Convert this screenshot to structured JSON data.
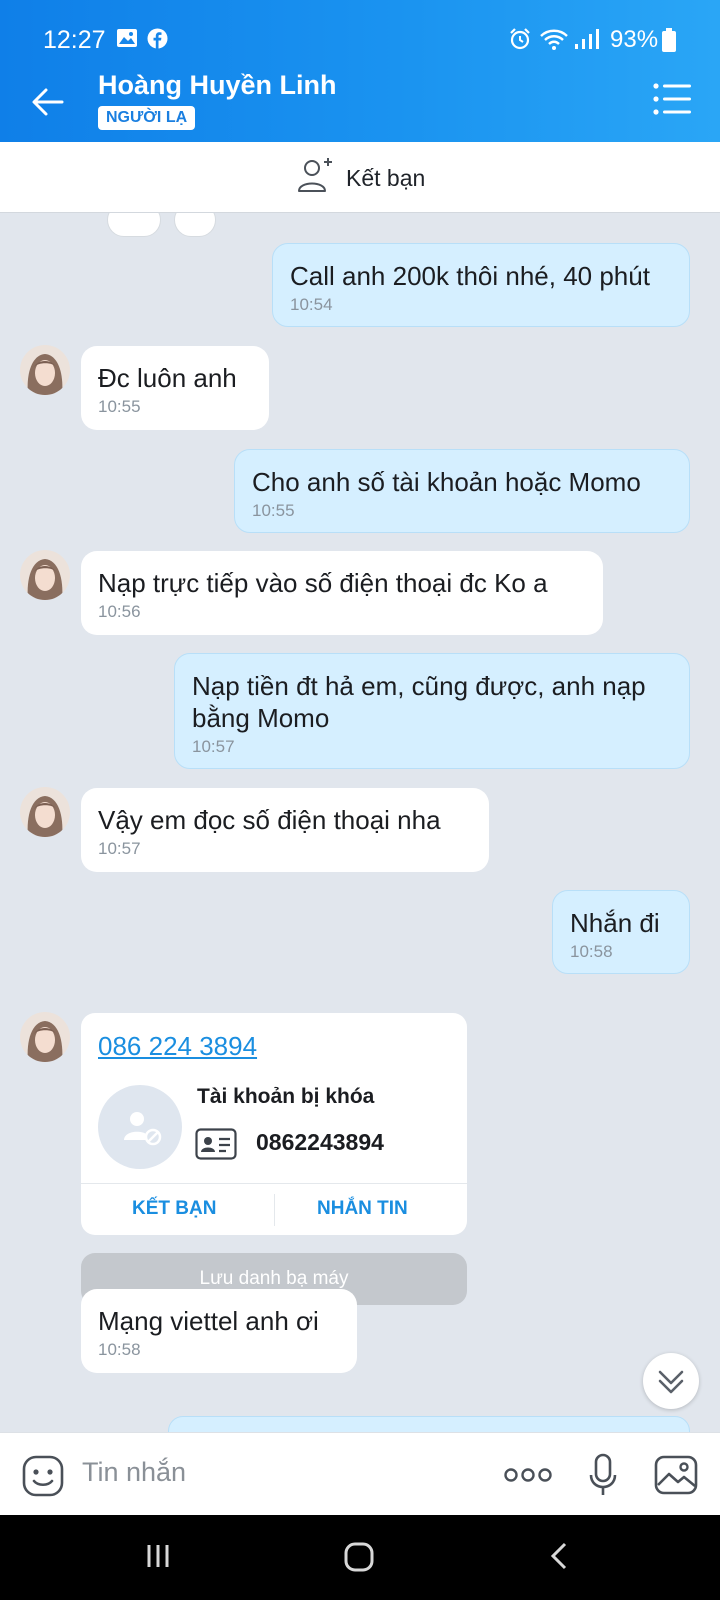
{
  "status_bar": {
    "time": "12:27",
    "battery": "93%"
  },
  "header": {
    "contact_name": "Hoàng Huyền Linh",
    "badge": "NGƯỜI LẠ"
  },
  "friend_bar": {
    "label": "Kết bạn"
  },
  "messages": [
    {
      "dir": "out",
      "text": "Call anh 200k thôi nhé, 40 phút",
      "time": "10:54"
    },
    {
      "dir": "in",
      "text": "Đc luôn anh",
      "time": "10:55"
    },
    {
      "dir": "out",
      "text": "Cho anh số tài khoản  hoặc Momo",
      "time": "10:55"
    },
    {
      "dir": "in",
      "text": "Nạp trực tiếp vào số điện thoại đc Ko a",
      "time": "10:56"
    },
    {
      "dir": "out",
      "text": "Nạp tiền đt hả em, cũng được, anh nạp bằng Momo",
      "time": "10:57"
    },
    {
      "dir": "in",
      "text": "Vậy em đọc số điện thoại nha",
      "time": "10:57"
    },
    {
      "dir": "out",
      "text": "Nhắn đi",
      "time": "10:58"
    },
    {
      "dir": "in",
      "text": "Mạng viettel anh ơi",
      "time": "10:58"
    }
  ],
  "contact_card": {
    "phone_link": "086 224 3894",
    "status": "Tài khoản bị khóa",
    "phone": "0862243894",
    "add_friend": "KẾT BẠN",
    "message": "NHẮN TIN"
  },
  "save_contact": "Lưu danh bạ máy",
  "input": {
    "placeholder": "Tin nhắn"
  },
  "colors": {
    "header_gradient_start": "#0f7fe8",
    "header_gradient_end": "#2aa6f6",
    "outgoing_bubble": "#d5efff",
    "link": "#1a8ee0"
  }
}
